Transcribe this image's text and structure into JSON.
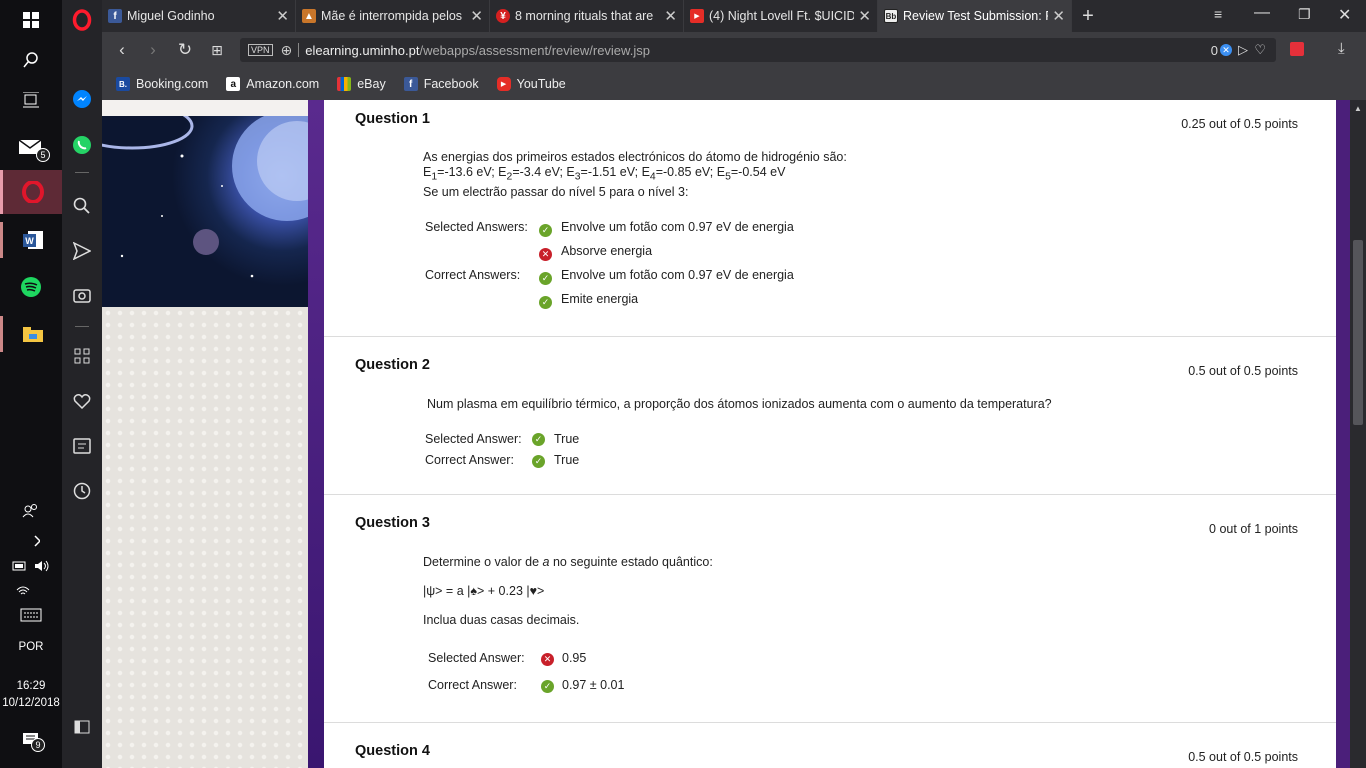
{
  "taskbar": {
    "mail_badge": "5",
    "lang": "POR",
    "time": "16:29",
    "date": "10/12/2018",
    "notif_badge": "9"
  },
  "tabs": [
    {
      "title": "Miguel Godinho",
      "icon": "facebook-icon",
      "color": "#3b5998"
    },
    {
      "title": "Mãe é interrompida pelos",
      "icon": "news-icon",
      "color": "#c9762a"
    },
    {
      "title": "8 morning rituals that are",
      "icon": "yen-icon",
      "color": "#d52020"
    },
    {
      "title": "(4) Night Lovell Ft. $UICIDE",
      "icon": "youtube-icon",
      "color": "#e52d27"
    },
    {
      "title": "Review Test Submission: F",
      "icon": "blackboard-icon",
      "color": "#222"
    }
  ],
  "address": {
    "vpn": "VPN",
    "host": "elearning.uminho.pt",
    "path": "/webapps/assessment/review/review.jsp",
    "block_count": "0"
  },
  "bookmarks": [
    {
      "label": "Booking.com",
      "icon": "booking-icon",
      "color": "#1a4aa0",
      "glyph": "B."
    },
    {
      "label": "Amazon.com",
      "icon": "amazon-icon",
      "color": "#ffffff",
      "glyph": "a"
    },
    {
      "label": "eBay",
      "icon": "ebay-icon",
      "color": "#e53238",
      "glyph": "e"
    },
    {
      "label": "Facebook",
      "icon": "facebook-icon",
      "color": "#3b5998",
      "glyph": "f"
    },
    {
      "label": "YouTube",
      "icon": "youtube-icon",
      "color": "#e52d27",
      "glyph": "▶"
    }
  ],
  "q1": {
    "title": "Question 1",
    "points": "0.25 out of 0.5 points",
    "line1": "As energias dos primeiros estados electrónicos do átomo de hidrogénio são:",
    "line3": "Se um electrão passar do nível 5 para o nível 3:",
    "selected_label": "Selected Answers:",
    "correct_label": "Correct Answers:",
    "sel1": "Envolve um fotão com 0.97 eV de energia",
    "sel2": "Absorve energia",
    "cor1": "Envolve um fotão com 0.97 eV de energia",
    "cor2": "Emite energia"
  },
  "q2": {
    "title": "Question 2",
    "points": "0.5 out of 0.5 points",
    "text": "Num plasma em equilíbrio térmico, a proporção dos átomos ionizados aumenta com o aumento da temperatura?",
    "selected_label": "Selected Answer:",
    "correct_label": "Correct Answer:",
    "sel": "True",
    "cor": "True"
  },
  "q3": {
    "title": "Question 3",
    "points": "0 out of 1 points",
    "text_pre": "Determine o valor de ",
    "text_var": "a",
    "text_post": " no seguinte estado quântico:",
    "state": "|ψ> = a |♠> + 0.23 |♥>",
    "note": "Inclua duas casas decimais.",
    "selected_label": "Selected Answer:",
    "correct_label": "Correct Answer:",
    "sel": "0.95",
    "cor": "0.97 ± 0.01"
  },
  "q4": {
    "title": "Question 4",
    "points": "0.5 out of 0.5 points"
  }
}
